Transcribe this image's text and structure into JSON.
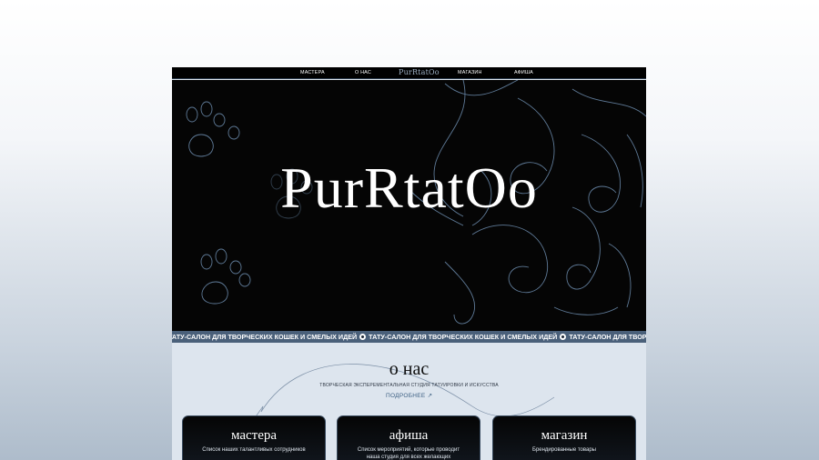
{
  "nav": {
    "items": [
      "МАСТЕРА",
      "О НАС",
      "PurRtatOo",
      "МАГАЗИН",
      "АФИША"
    ]
  },
  "hero": {
    "brand": "PurRtatOo"
  },
  "marquee": {
    "text": "ТАТУ-САЛОН ДЛЯ ТВОРЧЕСКИХ КОШЕК И СМЕЛЫХ ИДЕЙ"
  },
  "about": {
    "title": "о нас",
    "subtitle": "ТВОРЧЕСКАЯ ЭКСПЕРЕМЕНТАЛЬНАЯ СТУДИЯ ТАТУИРОВКИ И ИСКУССТВА",
    "more": "ПОДРОБНЕЕ ↗"
  },
  "cards": [
    {
      "title": "мастера",
      "desc": "Список наших талантливых сотрудников"
    },
    {
      "title": "афиша",
      "desc": "Список мероприятий, которые проводит наша студия для всех желающих"
    },
    {
      "title": "магазин",
      "desc": "Брендированные товары"
    }
  ],
  "colors": {
    "accent": "#4a607a",
    "hero_bg": "#050505",
    "section_bg": "#dde5ee",
    "link": "#3c5f82"
  }
}
